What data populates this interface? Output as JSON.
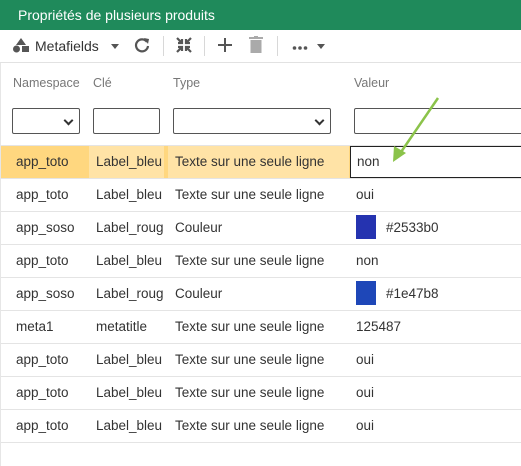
{
  "window": {
    "title": "Propriétés de plusieurs produits"
  },
  "toolbar": {
    "metafields_label": "Metafields",
    "icons": [
      "shapes-icon",
      "chevron-down-icon",
      "refresh-icon",
      "collapse-icon",
      "add-icon",
      "delete-icon",
      "more-icon",
      "chevron-down-icon"
    ]
  },
  "columns": {
    "namespace": "Namespace",
    "key": "Clé",
    "type": "Type",
    "value": "Valeur"
  },
  "filters": {
    "namespace": "",
    "key": "",
    "type": "",
    "value": ""
  },
  "rows": [
    {
      "namespace": "app_toto",
      "key": "Label_bleu",
      "type": "Texte sur une seule ligne",
      "value": "non",
      "selected": true
    },
    {
      "namespace": "app_toto",
      "key": "Label_bleu",
      "type": "Texte sur une seule ligne",
      "value": "oui"
    },
    {
      "namespace": "app_soso",
      "key": "Label_rouge",
      "type": "Couleur",
      "value": "#2533b0",
      "color": "#2533b0"
    },
    {
      "namespace": "app_toto",
      "key": "Label_bleu",
      "type": "Texte sur une seule ligne",
      "value": "non"
    },
    {
      "namespace": "app_soso",
      "key": "Label_rouge",
      "type": "Couleur",
      "value": "#1e47b8",
      "color": "#1e47b8"
    },
    {
      "namespace": "meta1",
      "key": "metatitle",
      "type": "Texte sur une seule ligne",
      "value": "125487"
    },
    {
      "namespace": "app_toto",
      "key": "Label_bleu",
      "type": "Texte sur une seule ligne",
      "value": "oui"
    },
    {
      "namespace": "app_toto",
      "key": "Label_bleu",
      "type": "Texte sur une seule ligne",
      "value": "oui"
    },
    {
      "namespace": "app_toto",
      "key": "Label_bleu",
      "type": "Texte sur une seule ligne",
      "value": "oui"
    }
  ],
  "colors": {
    "title_bar": "#1f8a5b",
    "selected_row": "#ffd77f",
    "annotation_arrow": "#8bc34a"
  }
}
